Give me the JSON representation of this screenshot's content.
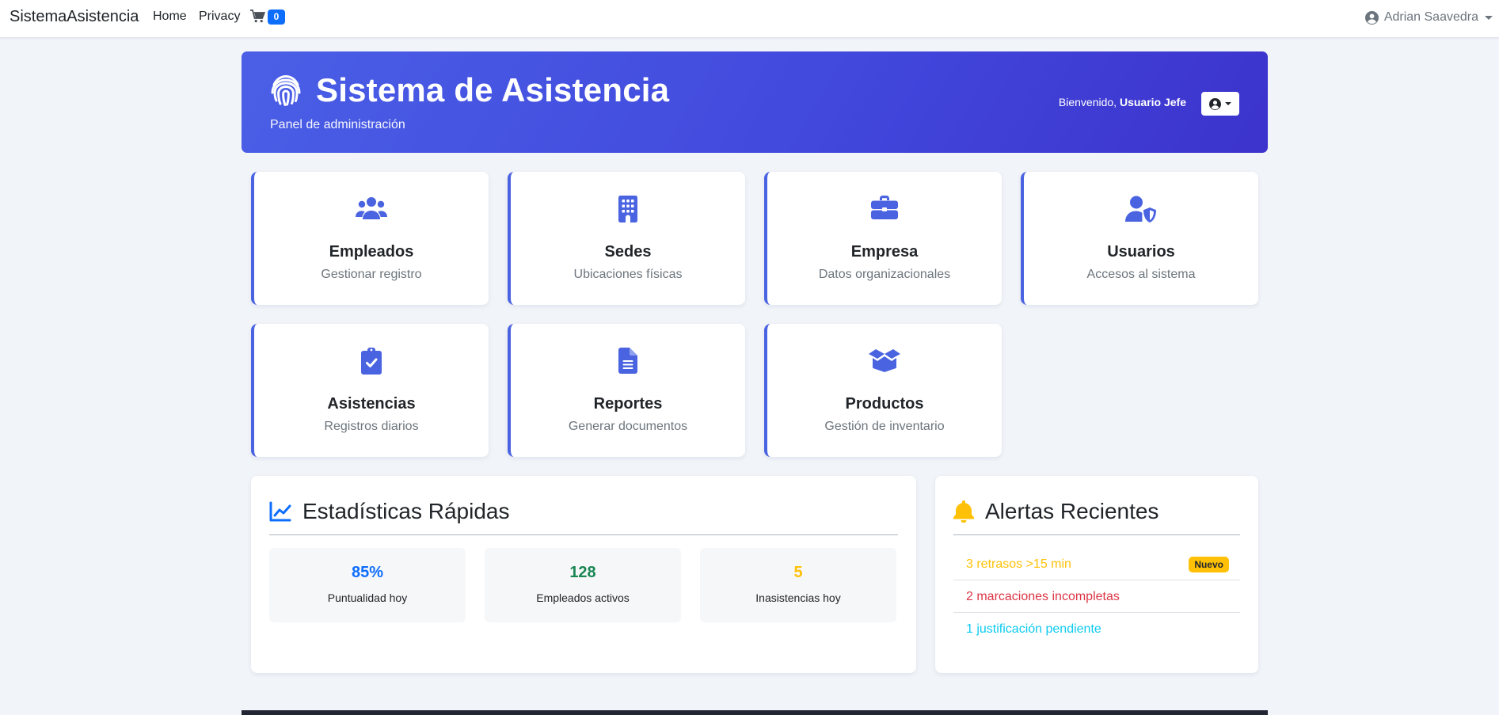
{
  "navbar": {
    "brand": "SistemaAsistencia",
    "links": [
      "Home",
      "Privacy"
    ],
    "cart_count": "0",
    "user_name": "Adrian Saavedra"
  },
  "hero": {
    "title": "Sistema de Asistencia",
    "subtitle": "Panel de administración",
    "welcome_prefix": "Bienvenido,",
    "welcome_user": "Usuario Jefe"
  },
  "modules": [
    {
      "title": "Empleados",
      "subtitle": "Gestionar registro",
      "icon": "users-icon"
    },
    {
      "title": "Sedes",
      "subtitle": "Ubicaciones físicas",
      "icon": "building-icon"
    },
    {
      "title": "Empresa",
      "subtitle": "Datos organizacionales",
      "icon": "briefcase-icon"
    },
    {
      "title": "Usuarios",
      "subtitle": "Accesos al sistema",
      "icon": "user-shield-icon"
    },
    {
      "title": "Asistencias",
      "subtitle": "Registros diarios",
      "icon": "clipboard-check-icon"
    },
    {
      "title": "Reportes",
      "subtitle": "Generar documentos",
      "icon": "file-icon"
    },
    {
      "title": "Productos",
      "subtitle": "Gestión de inventario",
      "icon": "box-open-icon"
    }
  ],
  "stats": {
    "title": "Estadísticas Rápidas",
    "items": [
      {
        "value": "85%",
        "label": "Puntualidad hoy",
        "color": "#0d6efd"
      },
      {
        "value": "128",
        "label": "Empleados activos",
        "color": "#198754"
      },
      {
        "value": "5",
        "label": "Inasistencias hoy",
        "color": "#ffc107"
      }
    ]
  },
  "alerts": {
    "title": "Alertas Recientes",
    "items": [
      {
        "text": "3 retrasos >15 min",
        "color": "#ffc107",
        "badge": "Nuevo"
      },
      {
        "text": "2 marcaciones incompletas",
        "color": "#dc3545"
      },
      {
        "text": "1 justificación pendiente",
        "color": "#0dcaf0"
      }
    ]
  },
  "colors": {
    "accent": "#4a63e0",
    "hero_gradient_start": "#4a5fe6",
    "hero_gradient_end": "#3c33cc",
    "badge_primary": "#0d6efd",
    "alert_bell": "#ffc107"
  }
}
